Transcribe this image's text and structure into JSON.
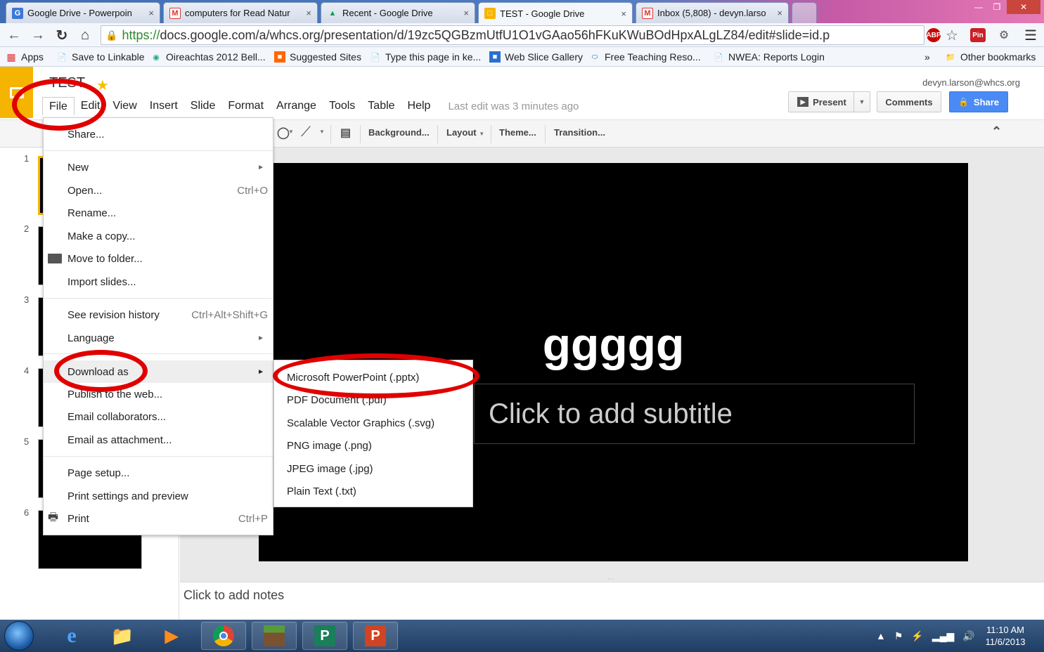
{
  "browser": {
    "tabs": [
      {
        "title": "Google Drive - Powerpoin",
        "favicon": "G"
      },
      {
        "title": "computers for Read Natur",
        "favicon": "M"
      },
      {
        "title": "Recent - Google Drive",
        "favicon": "▲"
      },
      {
        "title": "TEST - Google Drive",
        "favicon": "□"
      },
      {
        "title": "Inbox (5,808) - devyn.larso",
        "favicon": "M"
      }
    ],
    "tab_close": "×",
    "url_scheme": "https://",
    "url_rest": "docs.google.com/a/whcs.org/presentation/d/19zc5QGBzmUtfU1O1vGAao56hFKuKWuBOdHpxALgLZ84/edit#slide=id.p",
    "extensions": [
      "ABP",
      "Pin"
    ],
    "bookmarks": [
      {
        "label": "Apps"
      },
      {
        "label": "Save to Linkable"
      },
      {
        "label": "Oireachtas 2012 Bell..."
      },
      {
        "label": "Suggested Sites"
      },
      {
        "label": "Type this page in ke..."
      },
      {
        "label": "Web Slice Gallery"
      },
      {
        "label": "Free Teaching Reso..."
      },
      {
        "label": "NWEA: Reports Login"
      }
    ],
    "bookmarks_more": "»",
    "other_bookmarks": "Other bookmarks"
  },
  "app": {
    "title": "TEST",
    "menu": [
      "File",
      "Edit",
      "View",
      "Insert",
      "Slide",
      "Format",
      "Arrange",
      "Tools",
      "Table",
      "Help"
    ],
    "last_edit": "Last edit was 3 minutes ago",
    "account": "devyn.larson@whcs.org",
    "present_label": "Present",
    "comments_label": "Comments",
    "share_label": "Share"
  },
  "edit_toolbar": {
    "background": "Background...",
    "layout": "Layout",
    "theme": "Theme...",
    "transition": "Transition..."
  },
  "filmstrip": [
    "1",
    "2",
    "3",
    "4",
    "5",
    "6"
  ],
  "slide": {
    "title": "ggggg",
    "subtitle_placeholder": "Click to add subtitle"
  },
  "notes_placeholder": "Click to add notes",
  "file_menu": {
    "share": "Share...",
    "new": "New",
    "open": "Open...",
    "open_shortcut": "Ctrl+O",
    "rename": "Rename...",
    "make_copy": "Make a copy...",
    "move_to_folder": "Move to folder...",
    "import_slides": "Import slides...",
    "revision_history": "See revision history",
    "revision_shortcut": "Ctrl+Alt+Shift+G",
    "language": "Language",
    "download_as": "Download as",
    "publish": "Publish to the web...",
    "email_collaborators": "Email collaborators...",
    "email_attachment": "Email as attachment...",
    "page_setup": "Page setup...",
    "print_settings": "Print settings and preview",
    "print": "Print",
    "print_shortcut": "Ctrl+P"
  },
  "download_submenu": [
    "Microsoft PowerPoint (.pptx)",
    "PDF Document (.pdf)",
    "Scalable Vector Graphics (.svg)",
    "PNG image (.png)",
    "JPEG image (.jpg)",
    "Plain Text (.txt)"
  ],
  "taskbar": {
    "time": "11:10 AM",
    "date": "11/6/2013"
  },
  "colors": {
    "annotation": "#e00000",
    "share_button": "#4a8af4",
    "slides_logo": "#f5b400"
  }
}
